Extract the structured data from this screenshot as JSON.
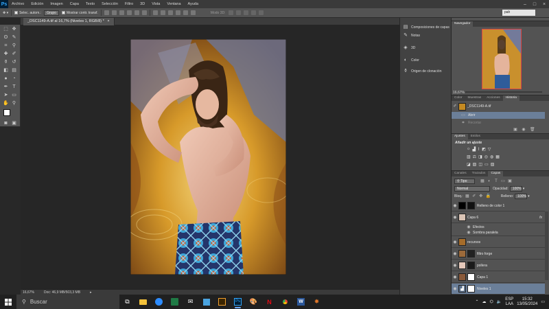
{
  "menu": {
    "logo": "Ps",
    "items": [
      "Archivo",
      "Edición",
      "Imagen",
      "Capa",
      "Texto",
      "Selección",
      "Filtro",
      "3D",
      "Vista",
      "Ventana",
      "Ayuda"
    ]
  },
  "options": {
    "auto_select": "Selec. autom.:",
    "group": "Grupo",
    "transform": "Mostrar contr. transf.",
    "mode3d": "Modo 3D:",
    "workspace": "pah"
  },
  "document": {
    "tab": "_DSC1149-A.tif al 16,7% (Niveles 1, RGB/8) *",
    "zoom": "16,67%",
    "doc_size": "Doc: 46,9 MB/503,3 MB"
  },
  "icon_panel": {
    "items": [
      "Composiciones de capas",
      "Notas",
      "3D",
      "Color",
      "Origen de clonación"
    ]
  },
  "navigator": {
    "tab": "Navegador",
    "zoom": "16,67%"
  },
  "history": {
    "tabs": [
      "Color",
      "Muestras",
      "Acciones",
      "Historia"
    ],
    "snapshot": "_DSC1149-A.tif",
    "states": [
      "Abrir",
      "Recortar"
    ]
  },
  "adjustments": {
    "tabs": [
      "Ajustes",
      "Estilos"
    ],
    "title": "Añadir un ajuste"
  },
  "layers_panel": {
    "tabs": [
      "Canales",
      "Trazados",
      "Capas"
    ],
    "filter": "Tipo",
    "blend": "Normal",
    "opacity_label": "Opacidad:",
    "opacity": "100%",
    "lock_label": "Bloq.:",
    "fill_label": "Relleno:",
    "fill": "100%",
    "layers": [
      {
        "name": "Relleno de color 1"
      },
      {
        "name": "Capa 6"
      },
      {
        "name": "Efectos"
      },
      {
        "name": "Sombra paralela"
      },
      {
        "name": "recursos"
      },
      {
        "name": "filtro forge"
      },
      {
        "name": "pollera"
      },
      {
        "name": "Capa 1"
      },
      {
        "name": "Niveles 1"
      }
    ]
  },
  "taskbar": {
    "search_placeholder": "Buscar",
    "lang_top": "ESP",
    "lang_bottom": "LAA",
    "time": "15:32",
    "date": "13/05/2024"
  },
  "colors": {
    "accent": "#6aa9ff",
    "photoshop_blue": "#31a8ff",
    "panel": "#535353"
  }
}
